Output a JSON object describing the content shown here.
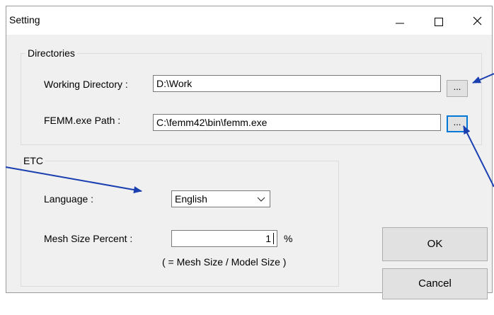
{
  "window": {
    "title": "Setting",
    "controls": {
      "minimize": "minimize-icon",
      "maximize": "maximize-icon",
      "close": "close-icon"
    }
  },
  "directories": {
    "group_label": "Directories",
    "working_dir_label": "Working Directory :",
    "working_dir_value": "D:\\Work",
    "femm_path_label": "FEMM.exe Path :",
    "femm_path_value": "C:\\femm42\\bin\\femm.exe",
    "browse_label": "..."
  },
  "etc": {
    "group_label": "ETC",
    "language_label": "Language :",
    "language_value": "English",
    "mesh_label": "Mesh Size Percent :",
    "mesh_value": "1",
    "mesh_unit": "%",
    "mesh_note": "( = Mesh Size / Model Size )"
  },
  "buttons": {
    "ok": "OK",
    "cancel": "Cancel"
  },
  "colors": {
    "annotation_arrow": "#1a3fb0",
    "focus": "#0078d7"
  }
}
